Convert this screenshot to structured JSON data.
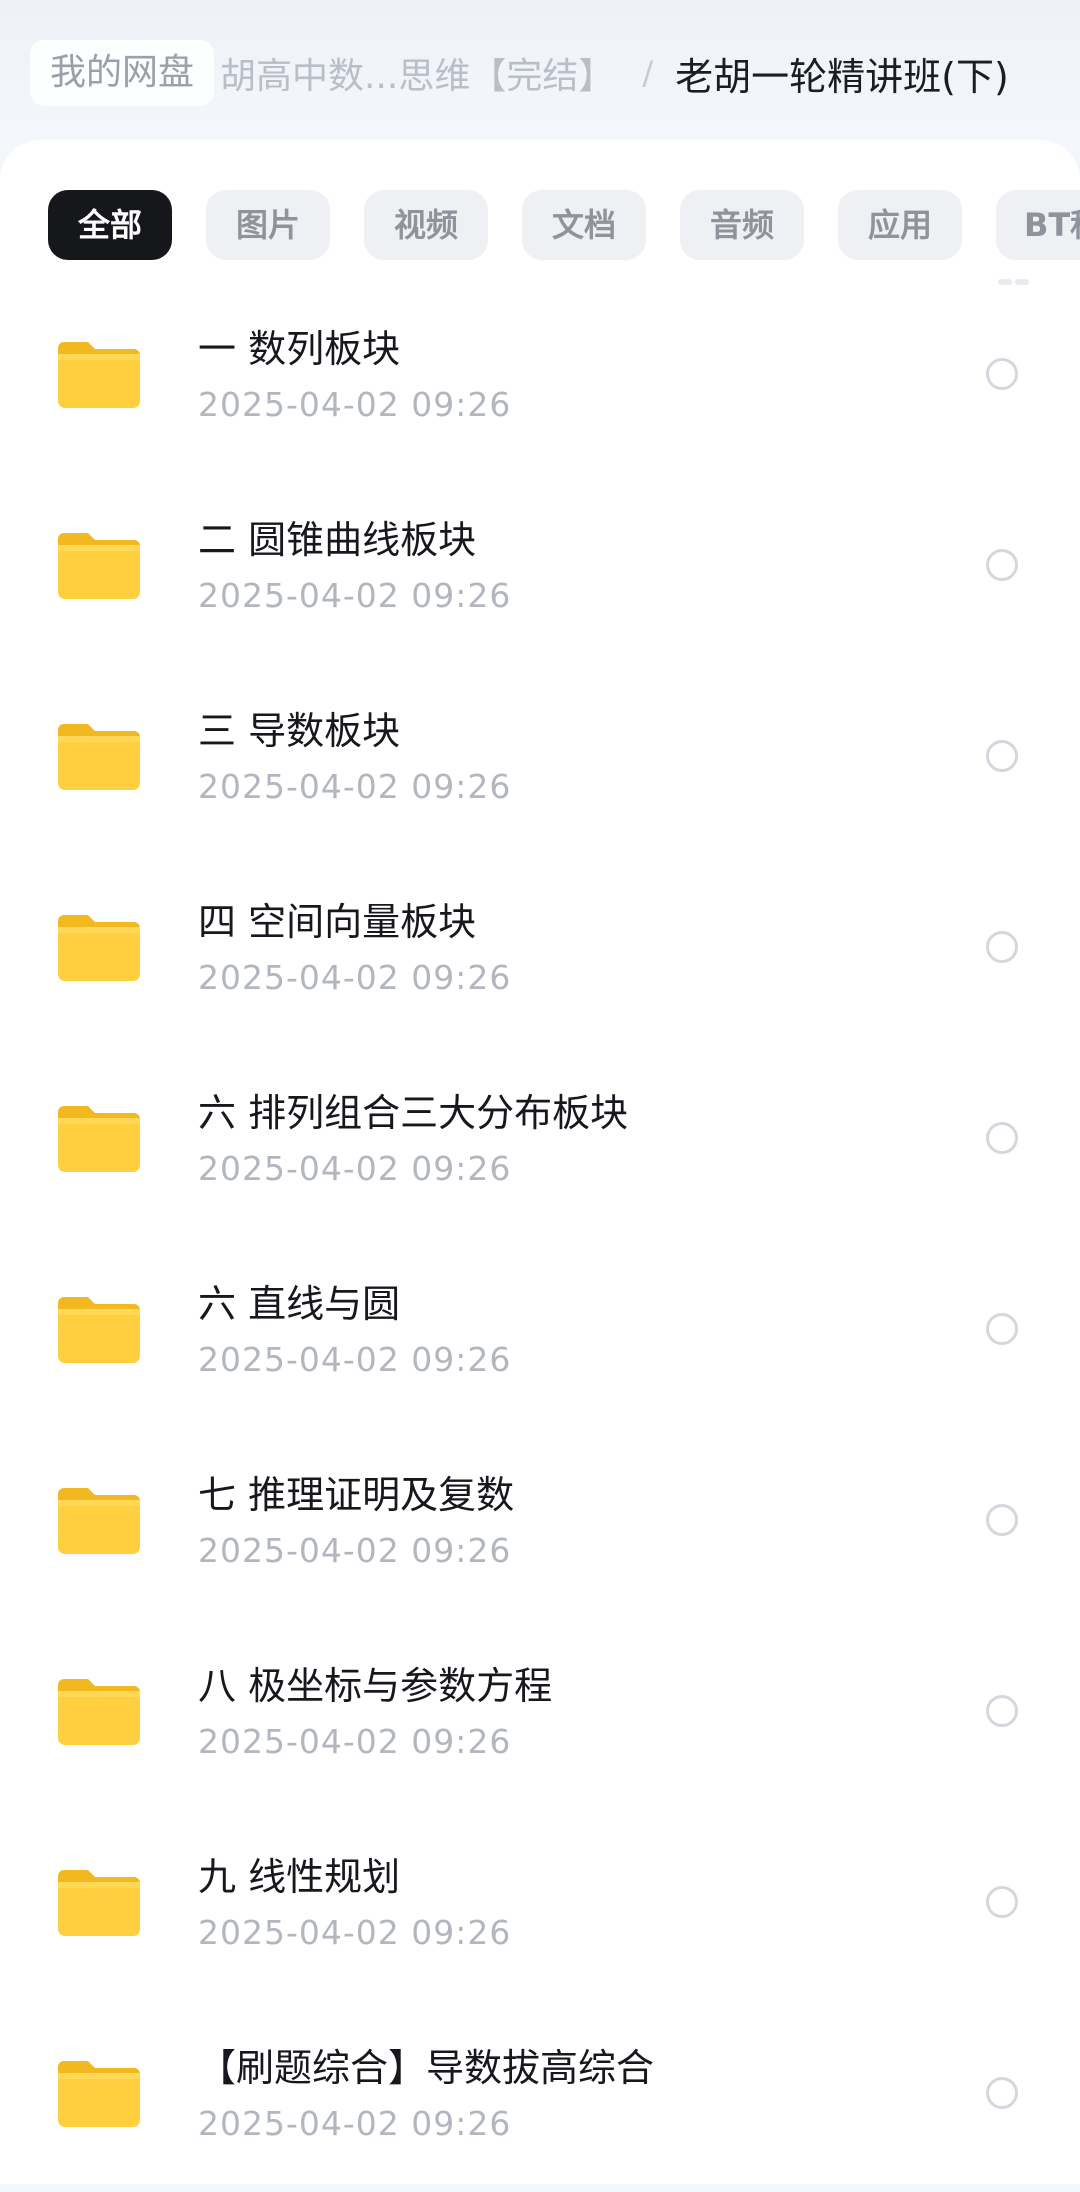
{
  "breadcrumb": {
    "root": "我的网盘",
    "middle": "胡高中数...思维【完结】",
    "separator": "/",
    "current": "老胡一轮精讲班(下)"
  },
  "tabs": [
    "全部",
    "图片",
    "视频",
    "文档",
    "音频",
    "应用",
    "BT种子"
  ],
  "active_tab": "全部",
  "colors": {
    "accent_dark": "#15171b",
    "folder_yellow": "#ffcf3f",
    "date_gray": "#b2b6be"
  },
  "files": [
    {
      "name": "一 数列板块",
      "date": "2025-04-02  09:26",
      "icon": "folder-icon"
    },
    {
      "name": "二 圆锥曲线板块",
      "date": "2025-04-02  09:26",
      "icon": "folder-icon"
    },
    {
      "name": "三 导数板块",
      "date": "2025-04-02  09:26",
      "icon": "folder-icon"
    },
    {
      "name": "四 空间向量板块",
      "date": "2025-04-02  09:26",
      "icon": "folder-icon"
    },
    {
      "name": "六 排列组合三大分布板块",
      "date": "2025-04-02  09:26",
      "icon": "folder-icon"
    },
    {
      "name": "六 直线与圆",
      "date": "2025-04-02  09:26",
      "icon": "folder-icon"
    },
    {
      "name": "七 推理证明及复数",
      "date": "2025-04-02  09:26",
      "icon": "folder-icon"
    },
    {
      "name": "八 极坐标与参数方程",
      "date": "2025-04-02  09:26",
      "icon": "folder-icon"
    },
    {
      "name": "九 线性规划",
      "date": "2025-04-02  09:26",
      "icon": "folder-icon"
    },
    {
      "name": "【刷题综合】导数拔高综合",
      "date": "2025-04-02  09:26",
      "icon": "folder-icon"
    }
  ]
}
